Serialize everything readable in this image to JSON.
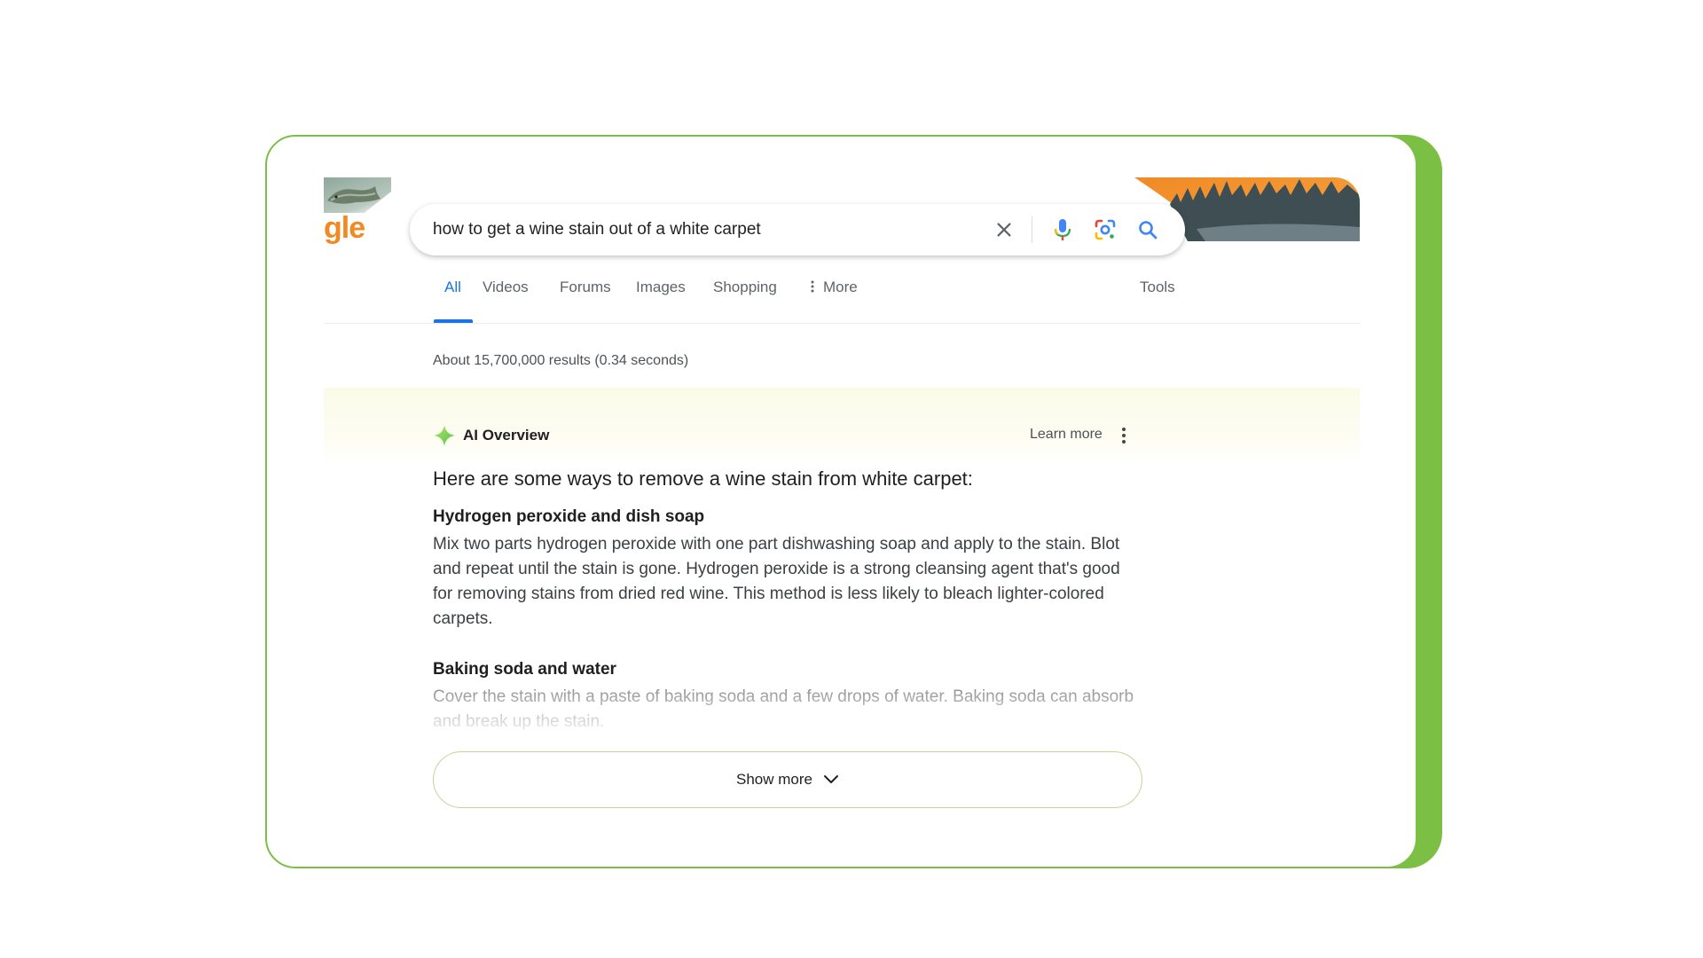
{
  "colors": {
    "frame_accent": "#7cbf45",
    "tab_active": "#1a73e8",
    "logo_orange": "#f08a24",
    "ai_band": "#fbfbe8"
  },
  "doodle": {
    "logo_text": "gle"
  },
  "search": {
    "query": "how to get a wine stain out of a white carpet",
    "icons": [
      "close-icon",
      "microphone-icon",
      "lens-icon",
      "search-icon"
    ]
  },
  "tabs": [
    {
      "label": "All",
      "active": true
    },
    {
      "label": "Videos",
      "active": false
    },
    {
      "label": "Forums",
      "active": false
    },
    {
      "label": "Images",
      "active": false
    },
    {
      "label": "Shopping",
      "active": false
    },
    {
      "label": "More",
      "active": false
    }
  ],
  "tools_label": "Tools",
  "results_count": "About 15,700,000 results (0.34 seconds)",
  "ai_overview": {
    "title": "AI Overview",
    "learn_more": "Learn more",
    "intro": "Here are some ways to remove a wine stain from white carpet:",
    "sections": [
      {
        "title": "Hydrogen peroxide and dish soap",
        "body": "Mix two parts hydrogen peroxide with one part dishwashing soap and apply to the stain. Blot and repeat until the stain is gone. Hydrogen peroxide is a strong cleansing agent that's good for removing stains from dried red wine. This method is less likely to bleach lighter-colored carpets."
      },
      {
        "title": "Baking soda and water",
        "body": "Cover the stain with a paste of baking soda and a few drops of water. Baking soda can absorb and break up the stain."
      }
    ],
    "show_more": "Show more"
  }
}
